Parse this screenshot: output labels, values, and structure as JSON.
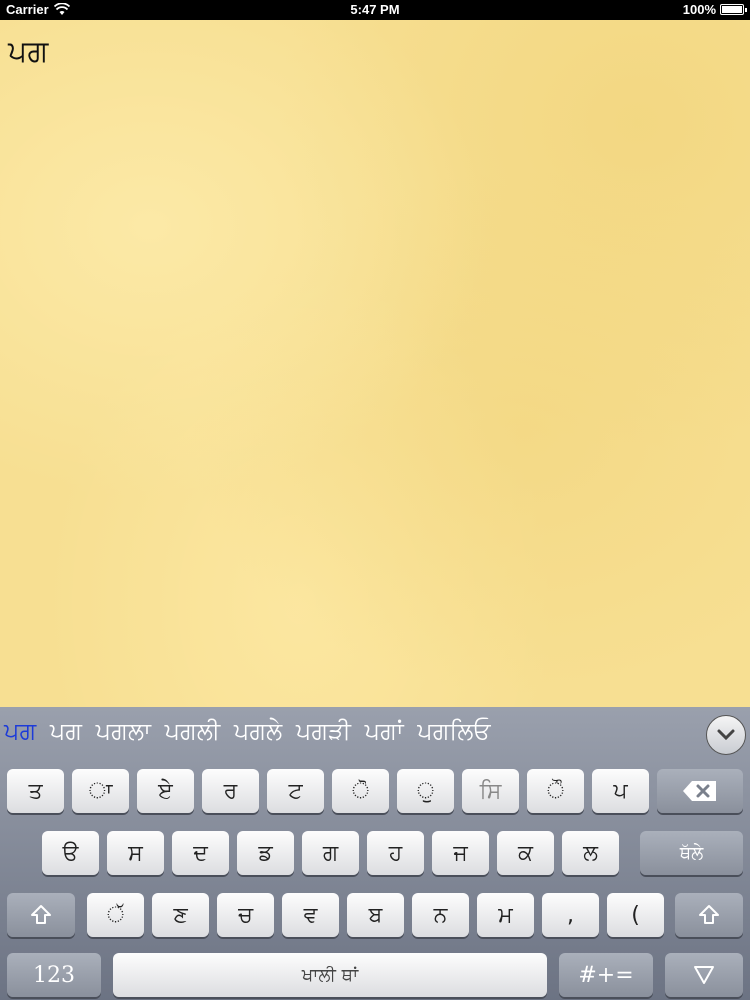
{
  "status_bar": {
    "carrier": "Carrier",
    "time": "5:47 PM",
    "battery": "100%"
  },
  "document": {
    "text": "ਪਗ"
  },
  "suggestions": {
    "current": "ਪਗ",
    "items": [
      "ਪਗ",
      "ਪਗਲਾ",
      "ਪਗਲੀ",
      "ਪਗਲੇ",
      "ਪਗੜੀ",
      "ਪਗਾਂ",
      "ਪਗਲਿਓ"
    ]
  },
  "keyboard": {
    "row1": [
      "ਤ",
      "◌ਾ",
      "ਏ",
      "ਰ",
      "ਟ",
      "◌ੋ",
      "◌ੁ",
      "ਸਿ",
      "◌ੌ",
      "ਪ"
    ],
    "row2": [
      "ੳ",
      "ਸ",
      "ਦ",
      "ਡ",
      "ਗ",
      "ਹ",
      "ਜ",
      "ਕ",
      "ਲ"
    ],
    "row3": [
      "◌ੱ",
      "ਣ",
      "ਚ",
      "ਵ",
      "ਬ",
      "ਨ",
      "ਮ",
      ",",
      "("
    ],
    "enter_label": "ਥੱਲੇ",
    "numbers_label": "123",
    "space_label": "ਖਾਲੀ ਥਾਂ",
    "symbols_label": "#+="
  }
}
